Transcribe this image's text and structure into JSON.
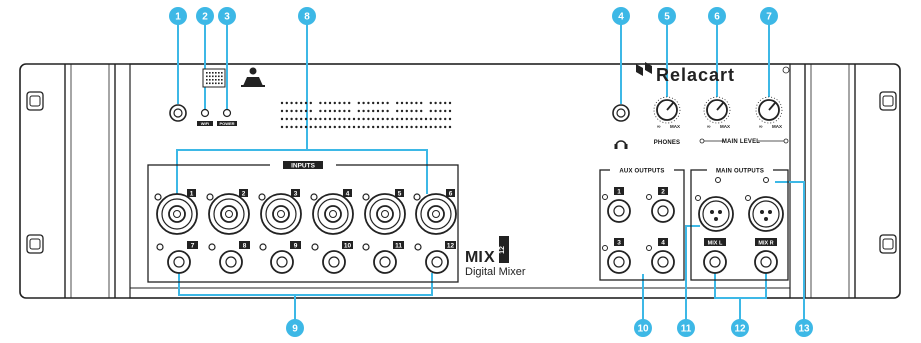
{
  "brand": {
    "name": "Relacart",
    "product_line_a": "MI",
    "product_line_b": "X",
    "product_num": "12",
    "subtitle": "Digital Mixer"
  },
  "panel": {
    "inputs_title": "INPUTS",
    "aux_outputs_title": "AUX OUTPUTS",
    "main_outputs_title": "MAIN OUTPUTS",
    "wifi_label": "WiFi",
    "power_label": "POWER",
    "phones_label": "PHONES",
    "main_level_label": "MAIN LEVEL",
    "min_mark": "∞",
    "max_mark": "MAX",
    "mix_l": "MIX L",
    "mix_r": "MIX R"
  },
  "combo_inputs": [
    "1",
    "2",
    "3",
    "4",
    "5",
    "6"
  ],
  "line_inputs": [
    "7",
    "8",
    "9",
    "10",
    "11",
    "12"
  ],
  "aux_outputs": [
    "1",
    "2",
    "3",
    "4"
  ],
  "callouts": [
    "1",
    "2",
    "3",
    "4",
    "5",
    "6",
    "7",
    "8",
    "9",
    "10",
    "11",
    "12",
    "13"
  ],
  "colors": {
    "callout": "#3db8e6",
    "line": "#3db8e6",
    "panel_stroke": "#222222"
  }
}
